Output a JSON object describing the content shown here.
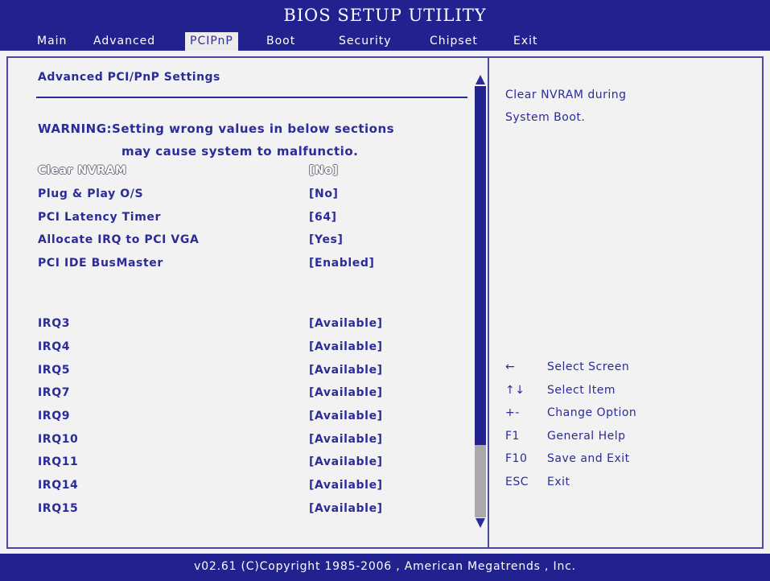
{
  "header": {
    "title": "BIOS SETUP UTILITY",
    "tabs": [
      "Main",
      "Advanced",
      "PCIPnP",
      "Boot",
      "Security",
      "Chipset",
      "Exit"
    ],
    "active_tab": "PCIPnP"
  },
  "main": {
    "heading": "Advanced PCI/PnP Settings",
    "warning_line1": "WARNING:Setting wrong values in below sections",
    "warning_line2": "may cause system to malfunctio.",
    "settings": [
      {
        "label": "Clear NVRAM",
        "value": "[No]"
      },
      {
        "label": "Plug & Play O/S",
        "value": "[No]"
      },
      {
        "label": "PCI Latency Timer",
        "value": "[64]"
      },
      {
        "label": "Allocate IRQ to PCI VGA",
        "value": "[Yes]"
      },
      {
        "label": "PCI IDE BusMaster",
        "value": "[Enabled]"
      },
      {
        "label": "IRQ3",
        "value": "[Available]"
      },
      {
        "label": "IRQ4",
        "value": "[Available]"
      },
      {
        "label": "IRQ5",
        "value": "[Available]"
      },
      {
        "label": "IRQ7",
        "value": "[Available]"
      },
      {
        "label": "IRQ9",
        "value": "[Available]"
      },
      {
        "label": "IRQ10",
        "value": "[Available]"
      },
      {
        "label": "IRQ11",
        "value": "[Available]"
      },
      {
        "label": "IRQ14",
        "value": "[Available]"
      },
      {
        "label": "IRQ15",
        "value": "[Available]"
      }
    ]
  },
  "help": {
    "line1": "Clear NVRAM during",
    "line2": "System Boot.",
    "keys": [
      {
        "key": "←",
        "desc": "Select Screen"
      },
      {
        "key": "↑↓",
        "desc": "Select Item"
      },
      {
        "key": "+-",
        "desc": "Change Option"
      },
      {
        "key": "F1",
        "desc": "General Help"
      },
      {
        "key": "F10",
        "desc": "Save and Exit"
      },
      {
        "key": "ESC",
        "desc": "Exit"
      }
    ]
  },
  "footer": {
    "text": "v02.61  (C)Copyright 1985-2006 , American Megatrends , Inc."
  },
  "colors": {
    "bar": "#21218f",
    "text": "#2b2b9a",
    "background": "#f2f2f2",
    "scroll_thumb": "#aaaaaa"
  }
}
